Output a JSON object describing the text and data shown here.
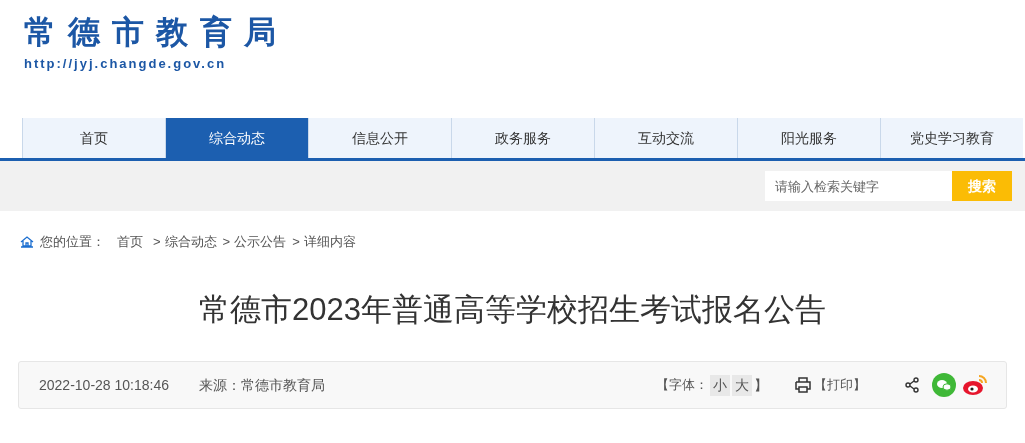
{
  "logo": {
    "title": "常德市教育局",
    "url": "http://jyj.changde.gov.cn"
  },
  "nav": [
    {
      "label": "首页",
      "selected": false
    },
    {
      "label": "综合动态",
      "selected": true
    },
    {
      "label": "信息公开",
      "selected": false
    },
    {
      "label": "政务服务",
      "selected": false
    },
    {
      "label": "互动交流",
      "selected": false
    },
    {
      "label": "阳光服务",
      "selected": false
    },
    {
      "label": "党史学习教育",
      "selected": false
    }
  ],
  "search": {
    "placeholder": "请输入检索关键字",
    "button": "搜索"
  },
  "breadcrumb": {
    "label": "您的位置：",
    "separator": ">",
    "items": [
      "首页",
      "综合动态",
      "公示公告",
      "详细内容"
    ]
  },
  "article": {
    "title": "常德市2023年普通高等学校招生考试报名公告",
    "date": "2022-10-28 10:18:46",
    "source": "来源：常德市教育局",
    "font_open": "【字体：",
    "font_sizes": [
      "小",
      "大"
    ],
    "font_close": "】",
    "print": "【打印】"
  }
}
